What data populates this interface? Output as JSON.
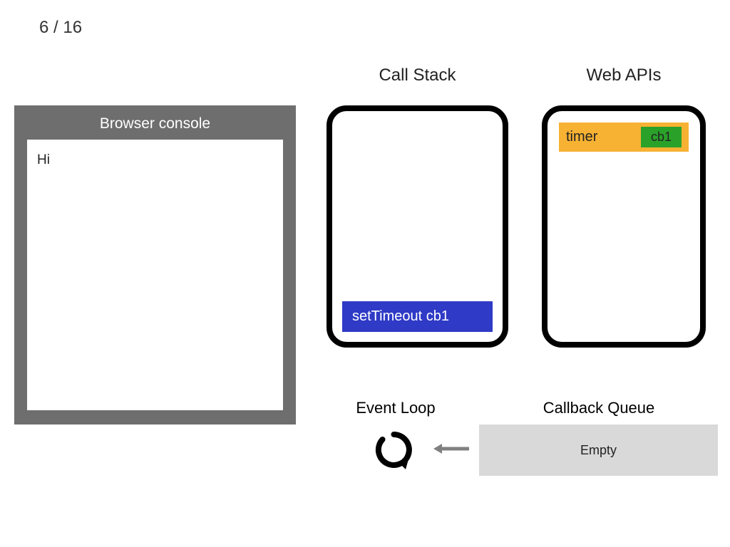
{
  "counter": "6 / 16",
  "console": {
    "title": "Browser console",
    "output": "Hi"
  },
  "call_stack": {
    "title": "Call Stack",
    "frames": [
      "setTimeout cb1"
    ]
  },
  "web_apis": {
    "title": "Web APIs",
    "timer_label": "timer",
    "callback_label": "cb1"
  },
  "event_loop": {
    "title": "Event Loop"
  },
  "callback_queue": {
    "title": "Callback Queue",
    "content": "Empty"
  },
  "colors": {
    "console_frame": "#6e6e6e",
    "stack_frame": "#2f3ac6",
    "timer_bg": "#f7b233",
    "cb_bg": "#2aa22a",
    "queue_bg": "#d9d9d9"
  }
}
